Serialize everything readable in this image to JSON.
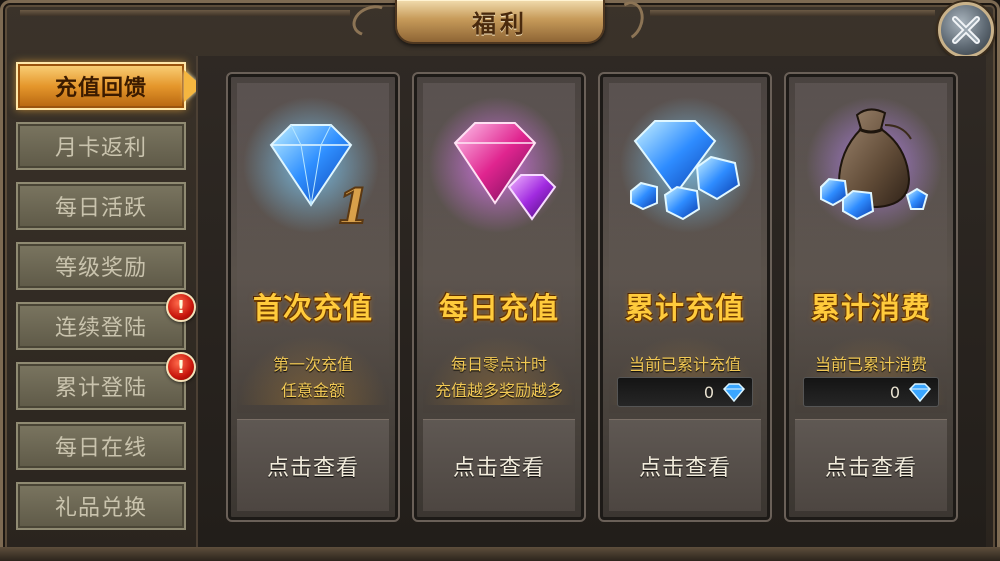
{
  "window": {
    "title": "福利",
    "close_icon": "close-x-icon"
  },
  "sidebar": {
    "items": [
      {
        "label": "充值回馈",
        "active": true,
        "badge": ""
      },
      {
        "label": "月卡返利",
        "active": false,
        "badge": ""
      },
      {
        "label": "每日活跃",
        "active": false,
        "badge": ""
      },
      {
        "label": "等级奖励",
        "active": false,
        "badge": ""
      },
      {
        "label": "连续登陆",
        "active": false,
        "badge": "!"
      },
      {
        "label": "累计登陆",
        "active": false,
        "badge": "!"
      },
      {
        "label": "每日在线",
        "active": false,
        "badge": ""
      },
      {
        "label": "礼品兑换",
        "active": false,
        "badge": ""
      }
    ]
  },
  "cards": [
    {
      "title": "首次充值",
      "desc_line1": "第一次充值",
      "desc_line2": "任意金额",
      "counter": "",
      "cta": "点击查看",
      "icon": "blue-diamond-number-one-icon",
      "glow": "#5fb8ff"
    },
    {
      "title": "每日充值",
      "desc_line1": "每日零点计时",
      "desc_line2": "充值越多奖励越多",
      "counter": "",
      "cta": "点击查看",
      "icon": "pink-diamonds-icon",
      "glow": "#d65cff"
    },
    {
      "title": "累计充值",
      "desc_line1": "当前已累计充值",
      "desc_line2": "",
      "counter": "0",
      "cta": "点击查看",
      "icon": "blue-diamond-pile-icon",
      "glow": "#5fb8ff"
    },
    {
      "title": "累计消费",
      "desc_line1": "当前已累计消费",
      "desc_line2": "",
      "counter": "0",
      "cta": "点击查看",
      "icon": "money-bag-diamonds-icon",
      "glow": "#b07cff"
    }
  ],
  "colors": {
    "accent_gold": "#ffcb3c",
    "active_tab": "#e5972c",
    "badge_red": "#c8160c"
  }
}
